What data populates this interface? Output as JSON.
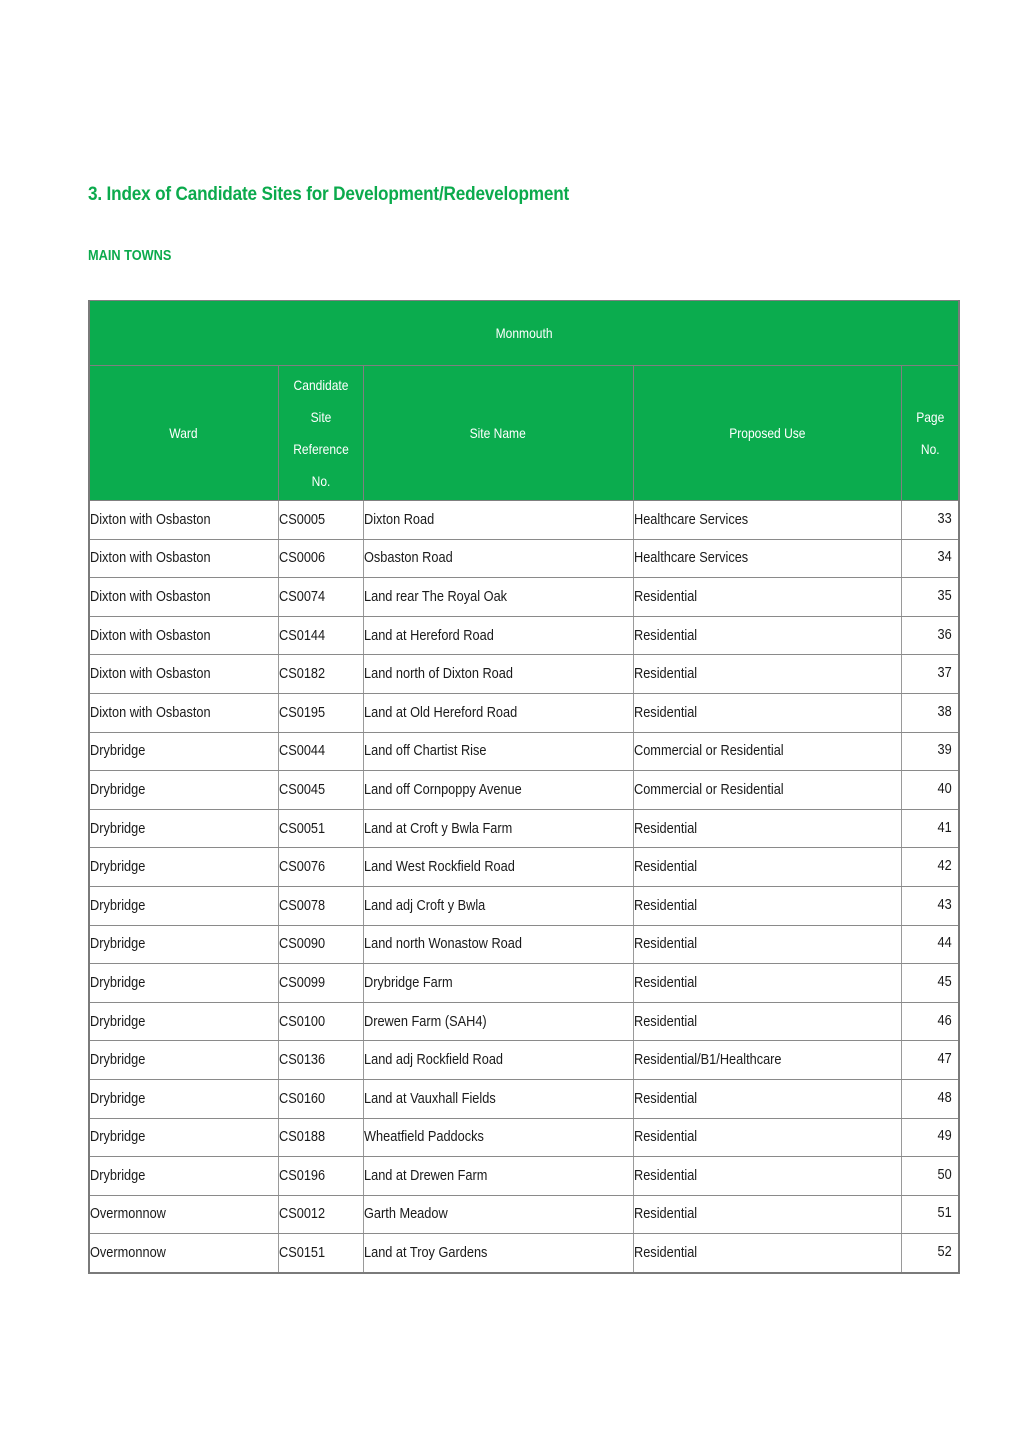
{
  "document": {
    "title": "3. Index of Candidate Sites for Development/Redevelopment",
    "section_label": "MAIN TOWNS",
    "title_color": "#0BAA4C",
    "header_color": "#0BAC4E"
  },
  "table": {
    "group_header": "Monmouth",
    "columns": [
      {
        "key": "ward",
        "label": "Ward"
      },
      {
        "key": "ref",
        "label": "Candidate Site Reference No."
      },
      {
        "key": "name",
        "label": "Site Name"
      },
      {
        "key": "use",
        "label": "Proposed Use"
      },
      {
        "key": "page",
        "label": "Page No."
      }
    ],
    "rows": [
      {
        "ward": "Dixton with Osbaston",
        "ref": "CS0005",
        "name": "Dixton Road",
        "use": "Healthcare Services",
        "page": "33"
      },
      {
        "ward": "Dixton with Osbaston",
        "ref": "CS0006",
        "name": "Osbaston Road",
        "use": "Healthcare Services",
        "page": "34"
      },
      {
        "ward": "Dixton with Osbaston",
        "ref": "CS0074",
        "name": "Land rear The Royal Oak",
        "use": "Residential",
        "page": "35"
      },
      {
        "ward": "Dixton with Osbaston",
        "ref": "CS0144",
        "name": "Land at Hereford Road",
        "use": "Residential",
        "page": "36"
      },
      {
        "ward": "Dixton with Osbaston",
        "ref": "CS0182",
        "name": "Land north of Dixton Road",
        "use": "Residential",
        "page": "37"
      },
      {
        "ward": "Dixton with Osbaston",
        "ref": "CS0195",
        "name": "Land at Old Hereford Road",
        "use": "Residential",
        "page": "38"
      },
      {
        "ward": "Drybridge",
        "ref": "CS0044",
        "name": "Land off Chartist Rise",
        "use": "Commercial or Residential",
        "page": "39"
      },
      {
        "ward": "Drybridge",
        "ref": "CS0045",
        "name": "Land off Cornpoppy Avenue",
        "use": "Commercial or Residential",
        "page": "40"
      },
      {
        "ward": "Drybridge",
        "ref": "CS0051",
        "name": "Land at Croft y Bwla Farm",
        "use": "Residential",
        "page": "41"
      },
      {
        "ward": "Drybridge",
        "ref": "CS0076",
        "name": "Land West Rockfield Road",
        "use": "Residential",
        "page": "42"
      },
      {
        "ward": "Drybridge",
        "ref": "CS0078",
        "name": "Land adj Croft y Bwla",
        "use": "Residential",
        "page": "43"
      },
      {
        "ward": "Drybridge",
        "ref": "CS0090",
        "name": "Land north Wonastow Road",
        "use": "Residential",
        "page": "44"
      },
      {
        "ward": "Drybridge",
        "ref": "CS0099",
        "name": "Drybridge Farm",
        "use": "Residential",
        "page": "45"
      },
      {
        "ward": "Drybridge",
        "ref": "CS0100",
        "name": "Drewen Farm (SAH4)",
        "use": "Residential",
        "page": "46"
      },
      {
        "ward": "Drybridge",
        "ref": "CS0136",
        "name": "Land adj Rockfield Road",
        "use": "Residential/B1/Healthcare",
        "page": "47"
      },
      {
        "ward": "Drybridge",
        "ref": "CS0160",
        "name": "Land at Vauxhall Fields",
        "use": "Residential",
        "page": "48"
      },
      {
        "ward": "Drybridge",
        "ref": "CS0188",
        "name": "Wheatfield Paddocks",
        "use": "Residential",
        "page": "49"
      },
      {
        "ward": "Drybridge",
        "ref": "CS0196",
        "name": "Land at Drewen Farm",
        "use": "Residential",
        "page": "50"
      },
      {
        "ward": "Overmonnow",
        "ref": "CS0012",
        "name": "Garth Meadow",
        "use": "Residential",
        "page": "51"
      },
      {
        "ward": "Overmonnow",
        "ref": "CS0151",
        "name": "Land at Troy Gardens",
        "use": "Residential",
        "page": "52"
      }
    ]
  }
}
